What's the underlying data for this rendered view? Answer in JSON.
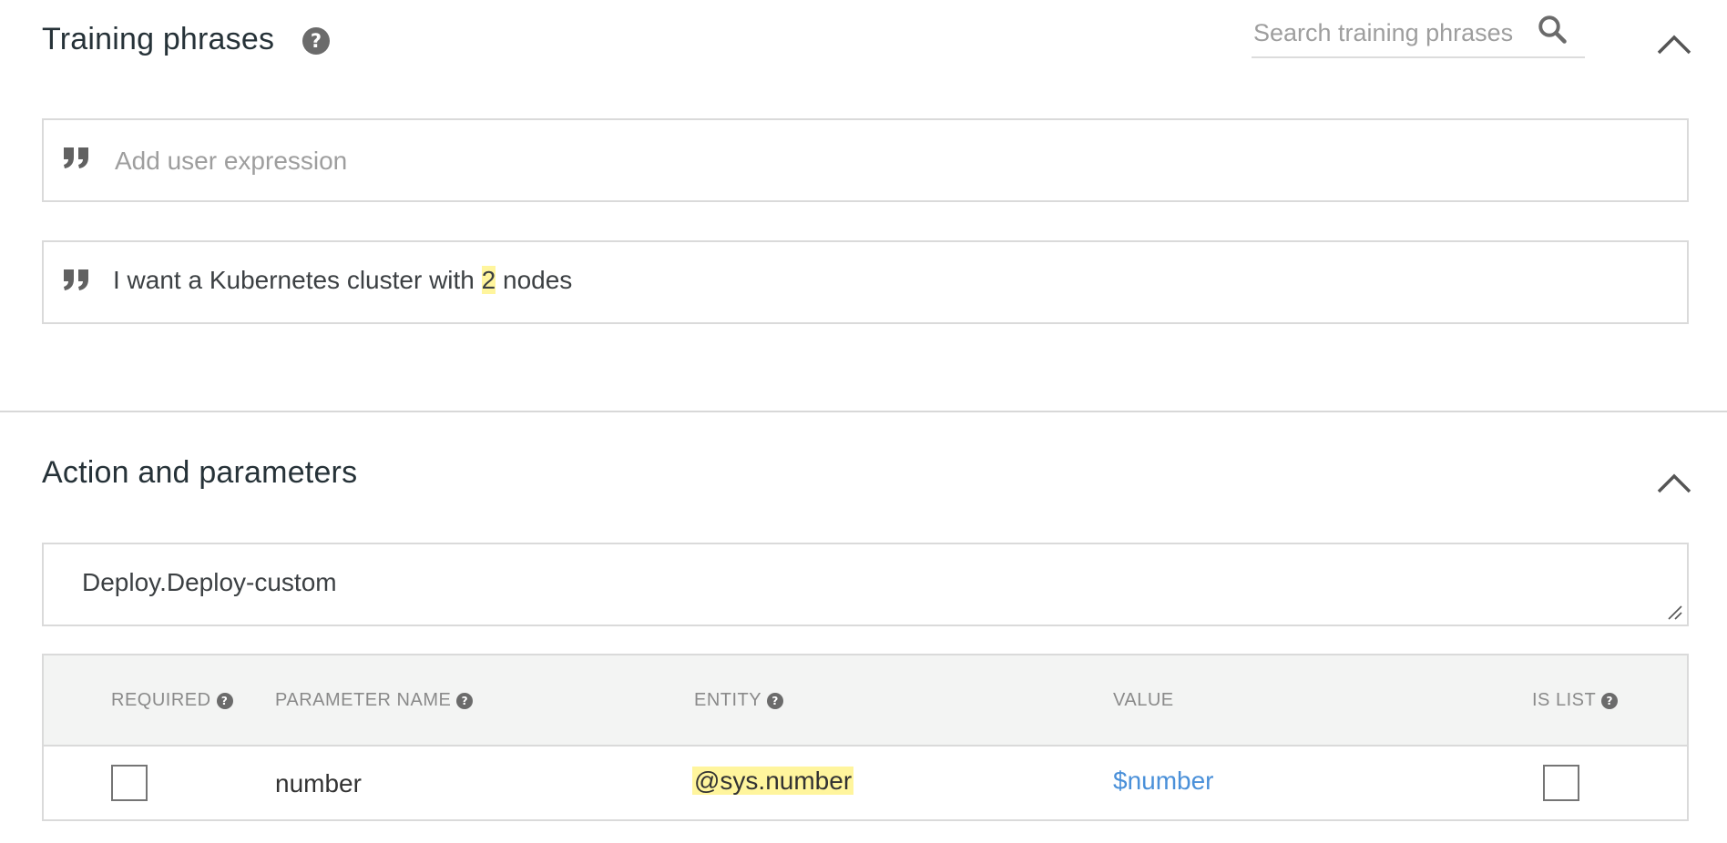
{
  "training": {
    "title": "Training phrases",
    "help_glyph": "?",
    "search_placeholder": "Search training phrases",
    "add_placeholder": "Add user expression",
    "phrase": {
      "before": "I want a Kubernetes cluster with ",
      "highlight": "2",
      "after": " nodes"
    }
  },
  "action": {
    "title": "Action and parameters",
    "action_name": "Deploy.Deploy-custom"
  },
  "params_table": {
    "headers": {
      "required": "REQUIRED",
      "parameter_name": "PARAMETER NAME",
      "entity": "ENTITY",
      "value": "VALUE",
      "is_list": "IS LIST"
    },
    "rows": [
      {
        "required": false,
        "parameter_name": "number",
        "entity": "@sys.number",
        "value": "$number",
        "is_list": false
      }
    ]
  },
  "icons": {
    "help": "help-circle-icon",
    "search": "search-icon",
    "collapse": "chevron-up-icon",
    "quote": "quote-icon",
    "resize": "resize-grip-icon"
  },
  "colors": {
    "highlight": "#fff59d",
    "link": "#4a90d9",
    "table_header_bg": "#f3f4f3"
  }
}
